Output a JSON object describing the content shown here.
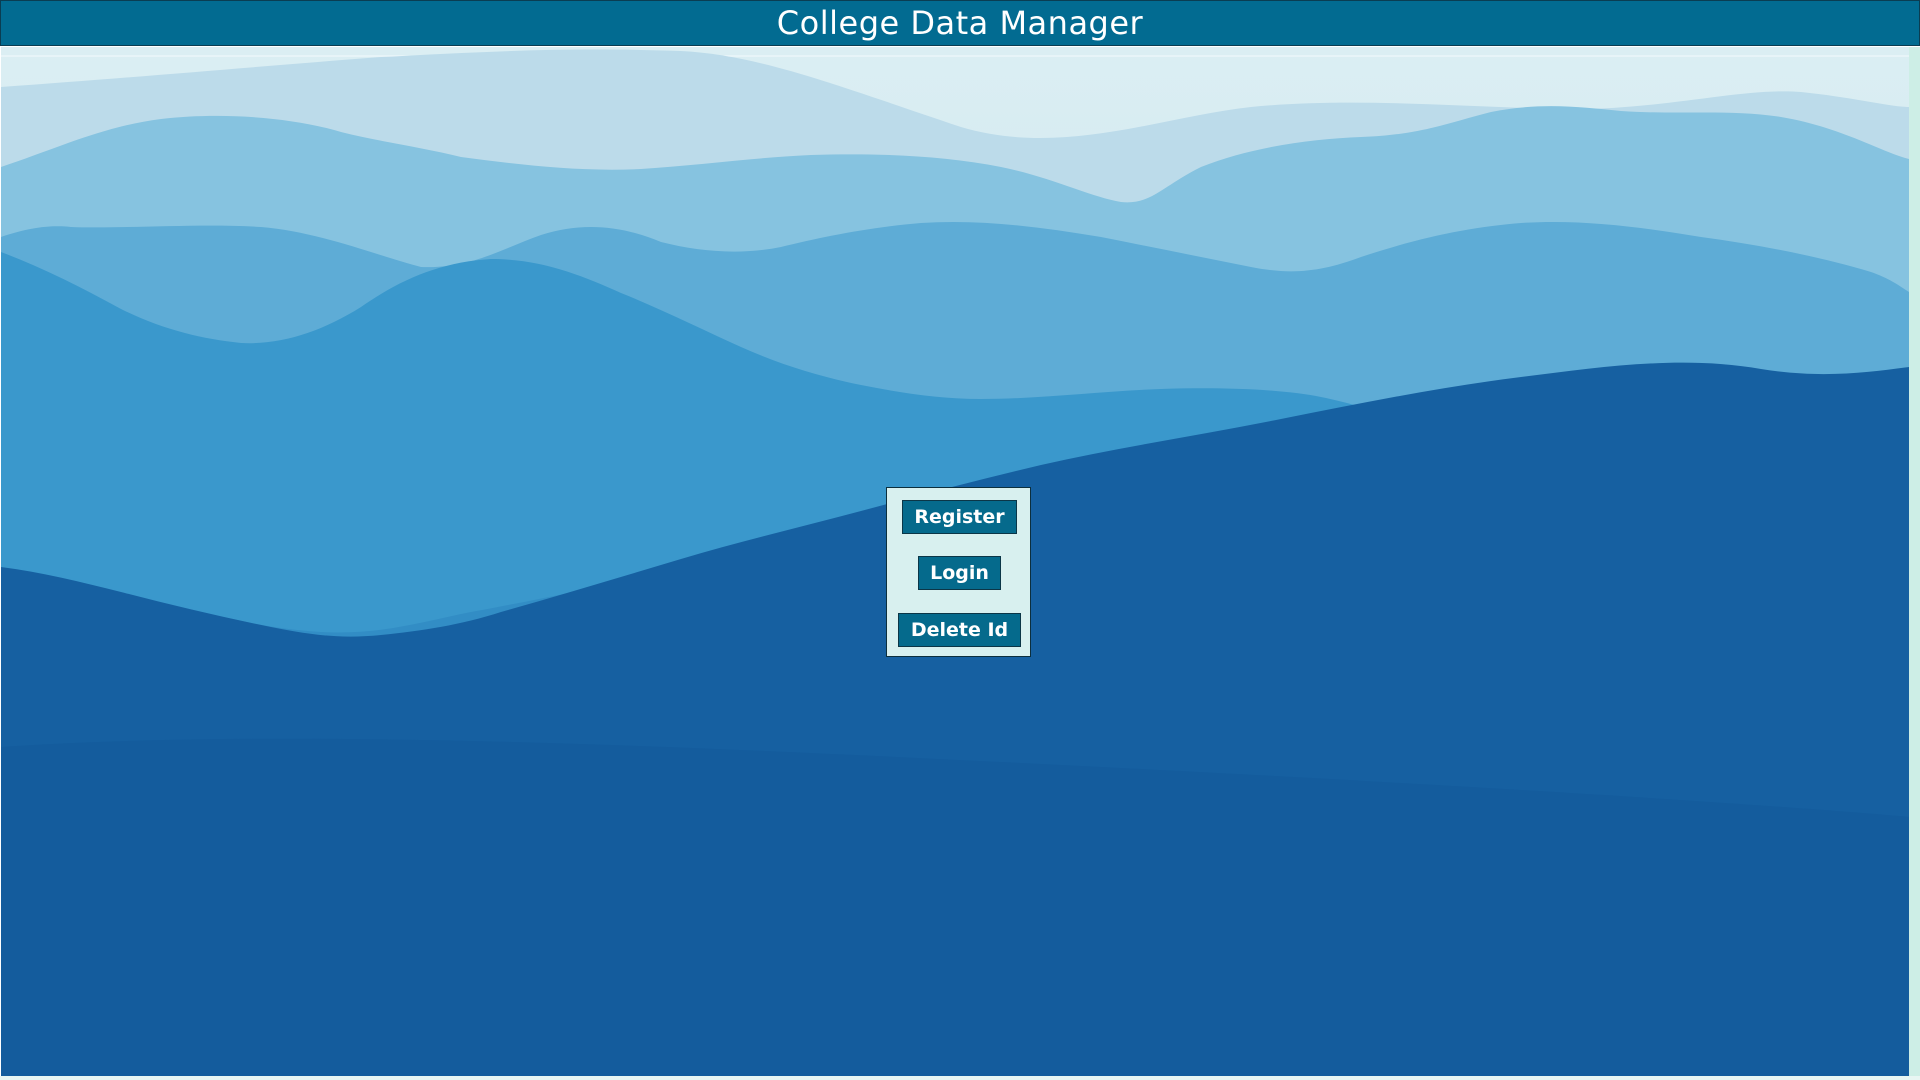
{
  "app": {
    "title": "College Data Manager"
  },
  "menu": {
    "register_label": "Register",
    "login_label": "Login",
    "delete_label": "Delete Id"
  },
  "colors": {
    "header_bg": "#026b91",
    "button_bg": "#056a8c",
    "panel_bg": "#d8f0ef"
  },
  "background": {
    "description_icon": "mountain-landscape"
  }
}
